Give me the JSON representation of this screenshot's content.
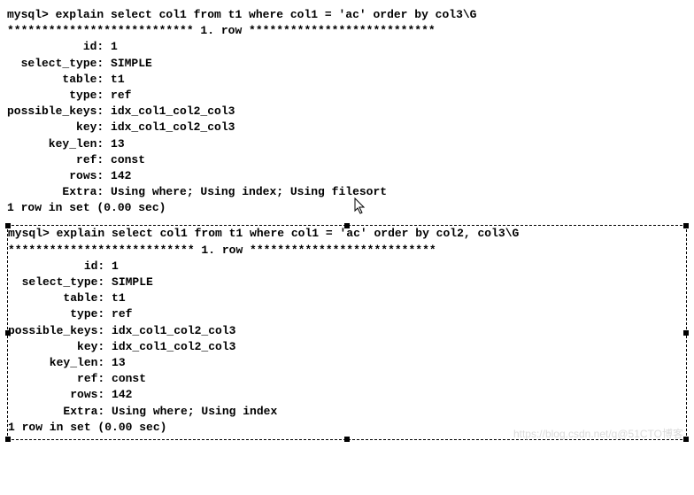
{
  "block1": {
    "prompt": "mysql> explain select col1 from t1 where col1 = 'ac' order by col3\\G",
    "sep": "*************************** 1. row ***************************",
    "rows": {
      "id": "           id: 1",
      "select_type": "  select_type: SIMPLE",
      "table": "        table: t1",
      "type": "         type: ref",
      "possible_keys": "possible_keys: idx_col1_col2_col3",
      "key": "          key: idx_col1_col2_col3",
      "key_len": "      key_len: 13",
      "ref": "          ref: const",
      "rows_ct": "         rows: 142",
      "extra": "        Extra: Using where; Using index; Using filesort"
    },
    "footer": "1 row in set (0.00 sec)"
  },
  "block2": {
    "prompt": "mysql> explain select col1 from t1 where col1 = 'ac' order by col2, col3\\G",
    "sep": "*************************** 1. row ***************************",
    "rows": {
      "id": "           id: 1",
      "select_type": "  select_type: SIMPLE",
      "table": "        table: t1",
      "type": "         type: ref",
      "possible_keys": "possible_keys: idx_col1_col2_col3",
      "key": "          key: idx_col1_col2_col3",
      "key_len": "      key_len: 13",
      "ref": "          ref: const",
      "rows_ct": "         rows: 142",
      "extra": "        Extra: Using where; Using index"
    },
    "footer": "1 row in set (0.00 sec)"
  },
  "watermark": "https://blog.csdn.net/q@51CTO博客"
}
